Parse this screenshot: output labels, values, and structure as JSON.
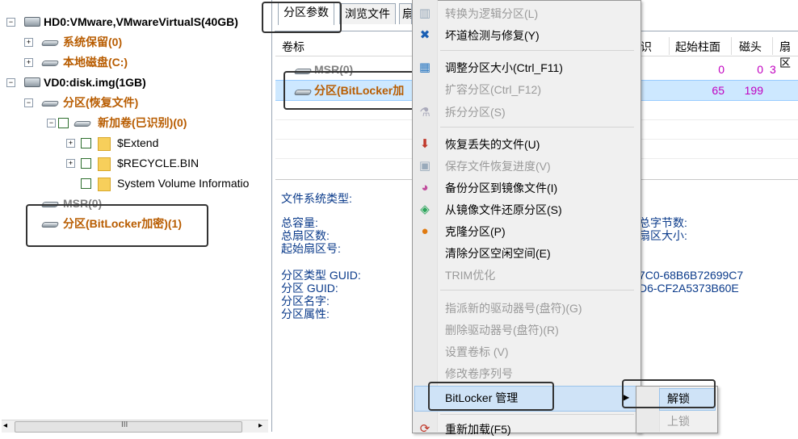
{
  "tree": {
    "hd0": "HD0:VMware,VMwareVirtualS(40GB)",
    "sys_reserved": "系统保留(0)",
    "local_disk": "本地磁盘(C:)",
    "vd0": "VD0:disk.img(1GB)",
    "partition_recover": "分区(恢复文件)",
    "new_volume": "新加卷(已识别)(0)",
    "extend": "$Extend",
    "recycle": "$RECYCLE.BIN",
    "svi": "System Volume Informatio",
    "msr": "MSR(0)",
    "bitlocker": "分区(BitLocker加密)(1)",
    "scroll_center": "III"
  },
  "tabs": {
    "partition_params": "分区参数",
    "browse_files": "浏览文件",
    "partial": "扇"
  },
  "table": {
    "col_volume": "卷标",
    "col_partial": "识",
    "col_start_cyl": "起始柱面",
    "col_head": "磁头",
    "col_sector": "扇区",
    "rows": [
      {
        "name": "MSR(0)",
        "start_cyl": "0",
        "head": "0",
        "sector": "3"
      },
      {
        "name": "分区(BitLocker加",
        "start_cyl": "65",
        "head": "199",
        "sector": ""
      }
    ]
  },
  "info": {
    "fs_type": "文件系统类型:",
    "total_capacity": "总容量:",
    "total_sectors": "总扇区数:",
    "start_sector": "起始扇区号:",
    "total_bytes": "总字节数:",
    "sector_size": "扇区大小:",
    "type_guid_label": "分区类型 GUID:",
    "part_guid_label": "分区 GUID:",
    "part_name_label": "分区名字:",
    "part_attr_label": "分区属性:",
    "type_guid_value": "7C0-68B6B72699C7",
    "part_guid_value": "D6-CF2A5373B60E"
  },
  "menu": {
    "convert_logical": "转换为逻辑分区(L)",
    "bad_track": "坏道检测与修复(Y)",
    "resize": "调整分区大小(Ctrl_F11)",
    "extend": "扩容分区(Ctrl_F12)",
    "split": "拆分分区(S)",
    "recover_lost": "恢复丢失的文件(U)",
    "save_progress": "保存文件恢复进度(V)",
    "backup_image": "备份分区到镜像文件(I)",
    "restore_image": "从镜像文件还原分区(S)",
    "clone": "克隆分区(P)",
    "clear_free": "清除分区空闲空间(E)",
    "trim": "TRIM优化",
    "assign_letter": "指派新的驱动器号(盘符)(G)",
    "remove_letter": "删除驱动器号(盘符)(R)",
    "set_label": "设置卷标 (V)",
    "modify_serial": "修改卷序列号",
    "bitlocker": "BitLocker 管理",
    "reload": "重新加载(F5)"
  },
  "submenu": {
    "unlock": "解锁",
    "lock": "上锁"
  }
}
